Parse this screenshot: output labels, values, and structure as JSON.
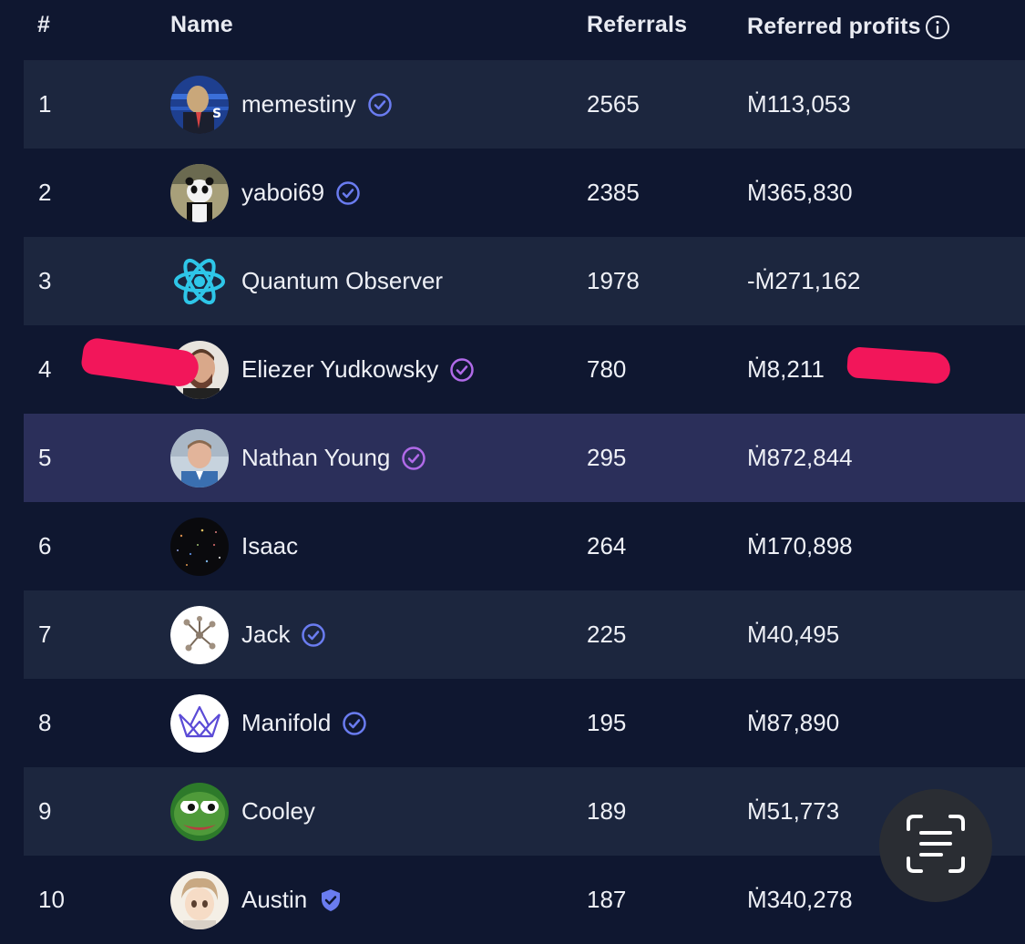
{
  "header": {
    "rank": "#",
    "name": "Name",
    "referrals": "Referrals",
    "profits": "Referred profits"
  },
  "colors": {
    "background": "#0f1730",
    "row_alt": "#1c263e",
    "row_highlight": "#2b2f5a",
    "badge_blue": "#6a7cf0",
    "badge_purple": "#b06ae8",
    "redaction": "#f2165a"
  },
  "rows": [
    {
      "rank": "1",
      "name": "memestiny",
      "referrals": "2565",
      "profits": "Ṁ113,053",
      "badge": "verified-blue-icon"
    },
    {
      "rank": "2",
      "name": "yaboi69",
      "referrals": "2385",
      "profits": "Ṁ365,830",
      "badge": "verified-blue-icon"
    },
    {
      "rank": "3",
      "name": "Quantum Observer",
      "referrals": "1978",
      "profits": "-Ṁ271,162",
      "badge": ""
    },
    {
      "rank": "4",
      "name": "Eliezer Yudkowsky",
      "referrals": "780",
      "profits": "Ṁ8,211",
      "badge": "verified-purple-icon"
    },
    {
      "rank": "5",
      "name": "Nathan Young",
      "referrals": "295",
      "profits": "Ṁ872,844",
      "badge": "verified-purple-icon"
    },
    {
      "rank": "6",
      "name": "Isaac",
      "referrals": "264",
      "profits": "Ṁ170,898",
      "badge": ""
    },
    {
      "rank": "7",
      "name": "Jack",
      "referrals": "225",
      "profits": "Ṁ40,495",
      "badge": "verified-blue-icon"
    },
    {
      "rank": "8",
      "name": "Manifold",
      "referrals": "195",
      "profits": "Ṁ87,890",
      "badge": "verified-blue-icon"
    },
    {
      "rank": "9",
      "name": "Cooley",
      "referrals": "189",
      "profits": "Ṁ51,773",
      "badge": ""
    },
    {
      "rank": "10",
      "name": "Austin",
      "referrals": "187",
      "profits": "Ṁ340,278",
      "badge": "shield-check-icon"
    }
  ]
}
